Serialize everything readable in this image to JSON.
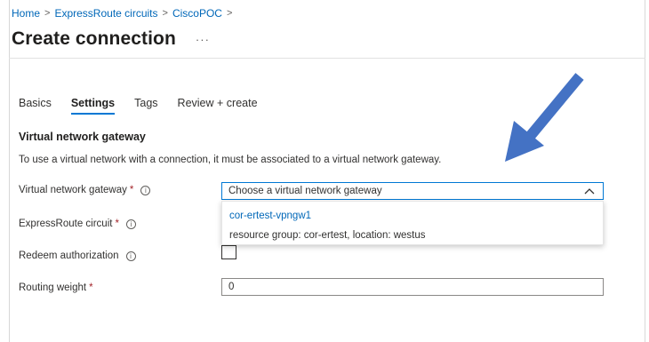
{
  "breadcrumb": {
    "items": [
      "Home",
      "ExpressRoute circuits",
      "CiscoPOC"
    ],
    "separator": ">"
  },
  "header": {
    "title": "Create connection",
    "more_label": "···"
  },
  "tabs": [
    {
      "label": "Basics",
      "active": false
    },
    {
      "label": "Settings",
      "active": true
    },
    {
      "label": "Tags",
      "active": false
    },
    {
      "label": "Review + create",
      "active": false
    }
  ],
  "section": {
    "title": "Virtual network gateway",
    "description": "To use a virtual network with a connection, it must be associated to a virtual network gateway."
  },
  "fields": {
    "gateway": {
      "label": "Virtual network gateway",
      "required_mark": "*",
      "info": "i",
      "placeholder": "Choose a virtual network gateway",
      "options": [
        {
          "name": "cor-ertest-vpngw1",
          "detail": "resource group: cor-ertest, location: westus"
        }
      ]
    },
    "circuit": {
      "label": "ExpressRoute circuit",
      "required_mark": "*",
      "info": "i"
    },
    "redeem": {
      "label": "Redeem authorization",
      "info": "i",
      "checked": false
    },
    "routing": {
      "label": "Routing weight",
      "required_mark": "*",
      "value": "0"
    }
  },
  "colors": {
    "accent": "#0078d4",
    "link": "#0067b8",
    "required": "#a4262c",
    "annotation_arrow": "#4472c4"
  },
  "icons": {
    "info": "info-circle-icon",
    "chevron": "chevron-up-icon",
    "annotation": "arrow-annotation-icon"
  }
}
